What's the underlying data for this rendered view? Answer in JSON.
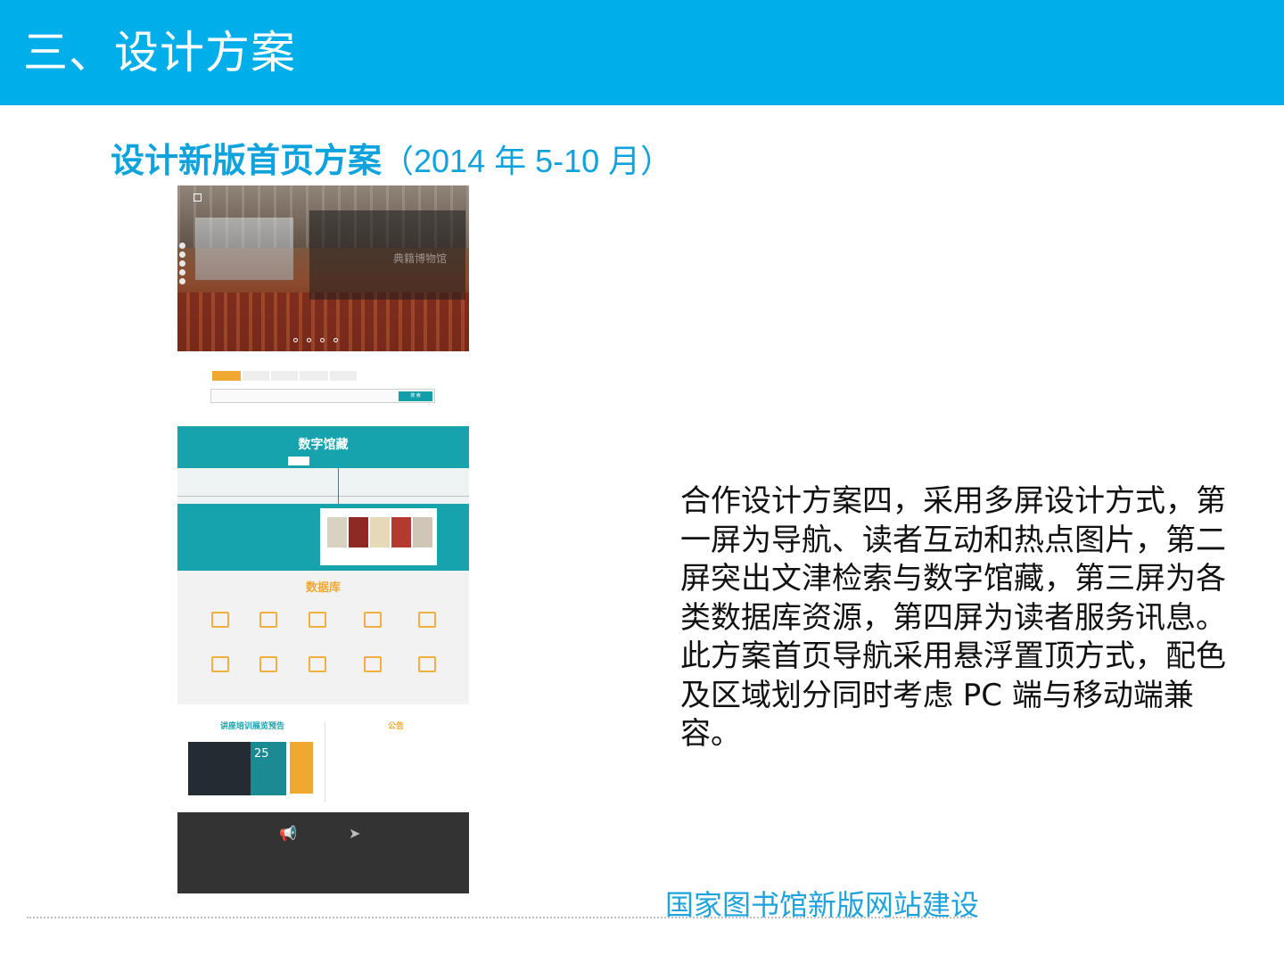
{
  "slide": {
    "title": "三、设计方案",
    "subtitle_main": "设计新版首页方案",
    "subtitle_date": "（2014 年 5-10 月）",
    "description": "合作设计方案四，采用多屏设计方式，第一屏为导航、读者互动和热点图片，第二屏突出文津检索与数字馆藏，第三屏为各类数据库资源，第四屏为读者服务讯息。此方案首页导航采用悬浮置顶方式，配色及区域划分同时考虑 PC 端与移动端兼容。",
    "footer_brand": "国家图书馆新版网站建设"
  },
  "mockup": {
    "hero": {
      "museum_text": "典籍博物馆"
    },
    "search": {
      "search_button": "搜 索"
    },
    "digital": {
      "title": "数字馆藏"
    },
    "database": {
      "title": "数据库"
    },
    "news": {
      "left_title": "讲座培训展览预告",
      "right_title": "公告",
      "today_number": "25"
    }
  },
  "colors": {
    "header": "#00aeea",
    "accent_blue": "#0ea3dd",
    "teal": "#17a3ad",
    "orange": "#f0a830",
    "footer_dark": "#333333"
  }
}
